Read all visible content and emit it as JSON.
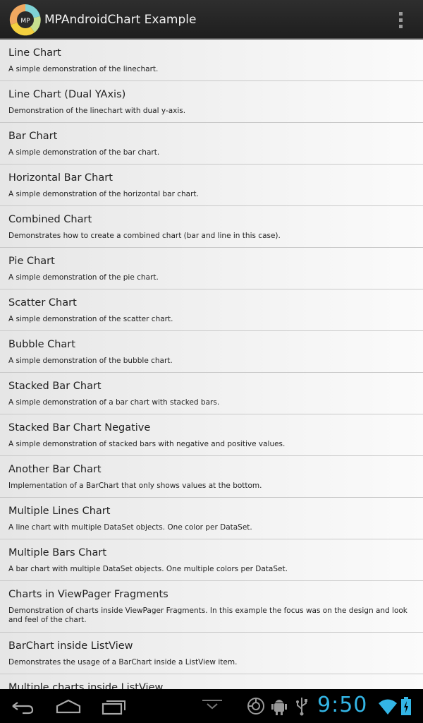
{
  "app": {
    "title": "MPAndroidChart Example",
    "icon_text": "MP"
  },
  "list": [
    {
      "title": "Line Chart",
      "desc": "A simple demonstration of the linechart."
    },
    {
      "title": "Line Chart (Dual YAxis)",
      "desc": "Demonstration of the linechart with dual y-axis."
    },
    {
      "title": "Bar Chart",
      "desc": "A simple demonstration of the bar chart."
    },
    {
      "title": "Horizontal Bar Chart",
      "desc": "A simple demonstration of the horizontal bar chart."
    },
    {
      "title": "Combined Chart",
      "desc": "Demonstrates how to create a combined chart (bar and line in this case)."
    },
    {
      "title": "Pie Chart",
      "desc": "A simple demonstration of the pie chart."
    },
    {
      "title": "Scatter Chart",
      "desc": "A simple demonstration of the scatter chart."
    },
    {
      "title": "Bubble Chart",
      "desc": "A simple demonstration of the bubble chart."
    },
    {
      "title": "Stacked Bar Chart",
      "desc": "A simple demonstration of a bar chart with stacked bars."
    },
    {
      "title": "Stacked Bar Chart Negative",
      "desc": "A simple demonstration of stacked bars with negative and positive values."
    },
    {
      "title": "Another Bar Chart",
      "desc": "Implementation of a BarChart that only shows values at the bottom."
    },
    {
      "title": "Multiple Lines Chart",
      "desc": "A line chart with multiple DataSet objects. One color per DataSet."
    },
    {
      "title": "Multiple Bars Chart",
      "desc": "A bar chart with multiple DataSet objects. One multiple colors per DataSet."
    },
    {
      "title": "Charts in ViewPager Fragments",
      "desc": "Demonstration of charts inside ViewPager Fragments. In this example the focus was on the design and look and feel of the chart."
    },
    {
      "title": "BarChart inside ListView",
      "desc": "Demonstrates the usage of a BarChart inside a ListView item."
    },
    {
      "title": "Multiple charts inside ListView",
      "desc": ""
    }
  ],
  "status": {
    "clock": "9:50"
  },
  "colors": {
    "accent": "#33b5e5",
    "icon_yellow": "#f4d03f",
    "icon_teal": "#7fd3d6",
    "icon_orange": "#f0a860",
    "icon_green": "#c7e08f"
  },
  "icons": [
    "back-icon",
    "home-icon",
    "recent-apps-icon",
    "hide-keyboard-icon",
    "sync-icon",
    "android-debug-icon",
    "usb-icon",
    "wifi-icon",
    "battery-icon"
  ]
}
